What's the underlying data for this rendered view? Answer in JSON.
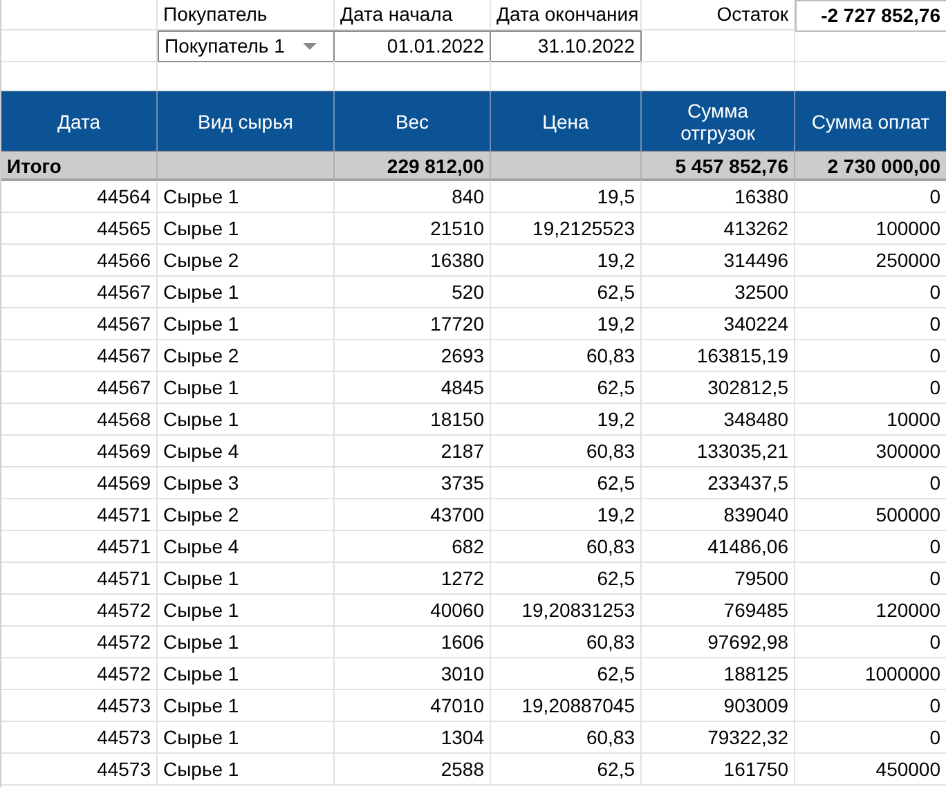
{
  "filters": {
    "buyer_label": "Покупатель",
    "start_label": "Дата начала",
    "end_label": "Дата окончания",
    "balance_label": "Остаток",
    "balance_value": "-2 727 852,76",
    "buyer": {
      "value": "Покупатель 1"
    },
    "start_date": "01.01.2022",
    "end_date": "31.10.2022"
  },
  "table": {
    "columns": [
      "Дата",
      "Вид сырья",
      "Вес",
      "Цена",
      "Сумма отгрузок",
      "Сумма оплат"
    ],
    "total": {
      "label": "Итого",
      "weight": "229 812,00",
      "shipments_sum": "5 457 852,76",
      "payments_sum": "2 730 000,00"
    },
    "rows": [
      [
        "44564",
        "Сырье 1",
        "840",
        "19,5",
        "16380",
        "0"
      ],
      [
        "44565",
        "Сырье 1",
        "21510",
        "19,2125523",
        "413262",
        "100000"
      ],
      [
        "44566",
        "Сырье 2",
        "16380",
        "19,2",
        "314496",
        "250000"
      ],
      [
        "44567",
        "Сырье 1",
        "520",
        "62,5",
        "32500",
        "0"
      ],
      [
        "44567",
        "Сырье 1",
        "17720",
        "19,2",
        "340224",
        "0"
      ],
      [
        "44567",
        "Сырье 2",
        "2693",
        "60,83",
        "163815,19",
        "0"
      ],
      [
        "44567",
        "Сырье 1",
        "4845",
        "62,5",
        "302812,5",
        "0"
      ],
      [
        "44568",
        "Сырье 1",
        "18150",
        "19,2",
        "348480",
        "10000"
      ],
      [
        "44569",
        "Сырье 4",
        "2187",
        "60,83",
        "133035,21",
        "300000"
      ],
      [
        "44569",
        "Сырье 3",
        "3735",
        "62,5",
        "233437,5",
        "0"
      ],
      [
        "44571",
        "Сырье 2",
        "43700",
        "19,2",
        "839040",
        "500000"
      ],
      [
        "44571",
        "Сырье 4",
        "682",
        "60,83",
        "41486,06",
        "0"
      ],
      [
        "44571",
        "Сырье 1",
        "1272",
        "62,5",
        "79500",
        "0"
      ],
      [
        "44572",
        "Сырье 1",
        "40060",
        "19,20831253",
        "769485",
        "120000"
      ],
      [
        "44572",
        "Сырье 1",
        "1606",
        "60,83",
        "97692,98",
        "0"
      ],
      [
        "44572",
        "Сырье 1",
        "3010",
        "62,5",
        "188125",
        "1000000"
      ],
      [
        "44573",
        "Сырье 1",
        "47010",
        "19,20887045",
        "903009",
        "0"
      ],
      [
        "44573",
        "Сырье 1",
        "1304",
        "60,83",
        "79322,32",
        "0"
      ],
      [
        "44573",
        "Сырье 1",
        "2588",
        "62,5",
        "161750",
        "450000"
      ]
    ]
  }
}
